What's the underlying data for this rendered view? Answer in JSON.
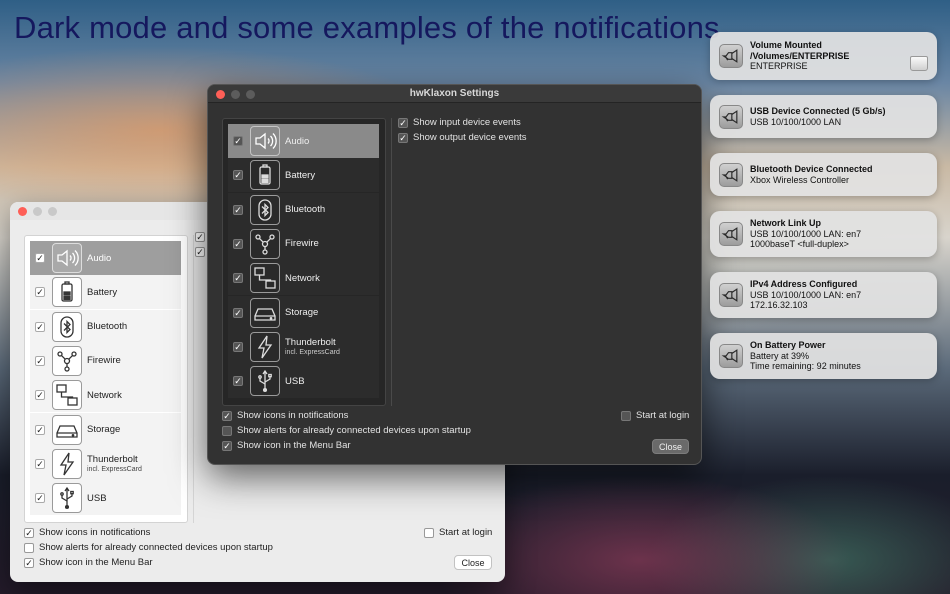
{
  "headline": "Dark mode and some examples of the notifications",
  "settings": {
    "sidebar": [
      {
        "label": "Audio",
        "sublabel": "",
        "icon": "speaker-icon",
        "checked": true,
        "selected": true
      },
      {
        "label": "Battery",
        "sublabel": "",
        "icon": "battery-icon",
        "checked": true,
        "selected": false
      },
      {
        "label": "Bluetooth",
        "sublabel": "",
        "icon": "bluetooth-icon",
        "checked": true,
        "selected": false
      },
      {
        "label": "Firewire",
        "sublabel": "",
        "icon": "firewire-icon",
        "checked": true,
        "selected": false
      },
      {
        "label": "Network",
        "sublabel": "",
        "icon": "network-icon",
        "checked": true,
        "selected": false
      },
      {
        "label": "Storage",
        "sublabel": "",
        "icon": "storage-icon",
        "checked": true,
        "selected": false
      },
      {
        "label": "Thunderbolt",
        "sublabel": "incl. ExpressCard",
        "icon": "thunderbolt-icon",
        "checked": true,
        "selected": false
      },
      {
        "label": "USB",
        "sublabel": "",
        "icon": "usb-icon",
        "checked": true,
        "selected": false
      }
    ],
    "detail": {
      "input_events": "Show input device events",
      "output_events": "Show output device events"
    },
    "bottom": {
      "show_icons": "Show icons in notifications",
      "show_alerts": "Show alerts for already connected devices upon startup",
      "show_menubar": "Show icon in the Menu Bar",
      "start_login": "Start at login",
      "close": "Close"
    },
    "checks": {
      "input_events": true,
      "output_events": true,
      "show_icons": true,
      "show_alerts": false,
      "show_menubar": true,
      "start_login": false
    }
  },
  "light_window": {
    "title": ""
  },
  "dark_window": {
    "title": "hwKlaxon Settings"
  },
  "notifications": [
    {
      "title": "Volume Mounted",
      "lines": [
        "/Volumes/ENTERPRISE",
        "ENTERPRISE"
      ],
      "title_bold_lines": 2,
      "drive_icon": true
    },
    {
      "title": "USB Device Connected (5 Gb/s)",
      "lines": [
        "USB 10/100/1000 LAN"
      ]
    },
    {
      "title": "Bluetooth Device Connected",
      "lines": [
        "Xbox Wireless Controller"
      ]
    },
    {
      "title": "Network Link Up",
      "lines": [
        "USB 10/100/1000 LAN: en7",
        "1000baseT <full-duplex>"
      ]
    },
    {
      "title": "IPv4 Address Configured",
      "lines": [
        "USB 10/100/1000 LAN: en7",
        "172.16.32.103"
      ]
    },
    {
      "title": "On Battery Power",
      "lines": [
        "Battery at 39%",
        "Time remaining: 92 minutes"
      ]
    }
  ],
  "colors": {
    "headline": "#15185e",
    "close_red": "#fe5f57",
    "selection_light": "#9e9e9e",
    "selection_dark": "#8a8a8a"
  }
}
